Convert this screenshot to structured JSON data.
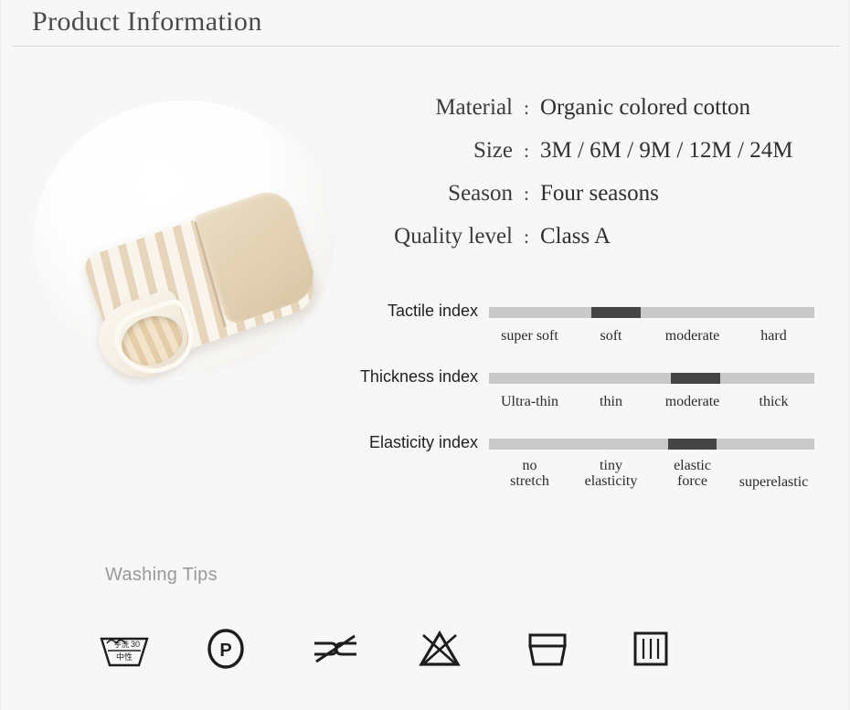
{
  "header": {
    "title": "Product Information"
  },
  "photo": {
    "alt_name": "product-photo-belly-band"
  },
  "specs": {
    "colon": ":",
    "rows": [
      {
        "label": "Material",
        "value": "Organic colored cotton"
      },
      {
        "label": "Size",
        "value": "3M / 6M / 9M / 12M / 24M"
      },
      {
        "label": "Season",
        "value": "Four seasons"
      },
      {
        "label": "Quality level",
        "value": "Class A"
      }
    ]
  },
  "scales": [
    {
      "name": "Tactile index",
      "ticks": [
        "super soft",
        "soft",
        "moderate",
        "hard"
      ],
      "selected_index": 1,
      "fill_left_pct": 31.5,
      "fill_width_pct": 15.0,
      "labels_two_line": false
    },
    {
      "name": "Thickness index",
      "ticks": [
        "Ultra-thin",
        "thin",
        "moderate",
        "thick"
      ],
      "selected_index": 2,
      "fill_left_pct": 56.0,
      "fill_width_pct": 15.0,
      "labels_two_line": false
    },
    {
      "name": "Elasticity index",
      "ticks": [
        "no\nstretch",
        "tiny\nelasticity",
        "elastic\nforce",
        "superelastic"
      ],
      "selected_index": 2,
      "fill_left_pct": 55.0,
      "fill_width_pct": 15.0,
      "labels_two_line": true
    }
  ],
  "washing": {
    "title": "Washing Tips",
    "icons": [
      {
        "name": "hand-wash-tub-icon",
        "label": "30"
      },
      {
        "name": "dry-clean-p-circle-icon",
        "label": "P"
      },
      {
        "name": "do-not-wring-icon",
        "label": ""
      },
      {
        "name": "do-not-bleach-triangle-icon",
        "label": ""
      },
      {
        "name": "dry-flat-icon",
        "label": ""
      },
      {
        "name": "drip-dry-square-icon",
        "label": ""
      }
    ]
  },
  "colors": {
    "background": "#f7f7f7",
    "bar_track": "#c9c9c9",
    "bar_fill": "#444444",
    "title_text": "#4a4a4a",
    "muted_text": "#9a9a9a"
  }
}
